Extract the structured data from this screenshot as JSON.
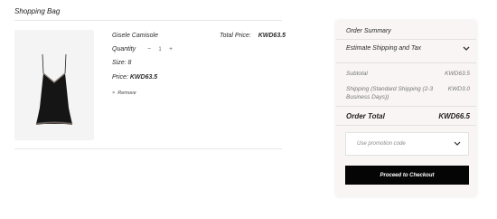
{
  "page": {
    "title": "Shopping Bag"
  },
  "item": {
    "name": "Gisele Camisole",
    "quantity_label": "Quantity",
    "quantity": "1",
    "size": "Size: 8",
    "price_label": "Price:",
    "price": "KWD63.5",
    "remove_label": "Remove",
    "total_label": "Total Price:",
    "total_value": "KWD63.5"
  },
  "summary": {
    "title": "Order Summary",
    "shipping_tax_label": "Estimate Shipping and Tax",
    "subtotal_label": "Subtotal",
    "subtotal_value": "KWD63.5",
    "shipping_label": "Shipping (Standard Shipping (2-3 Business Days))",
    "shipping_value": "KWD3.0",
    "order_total_label": "Order Total",
    "order_total_value": "KWD66.5",
    "promo_placeholder": "Use promotion code",
    "checkout_label": "Proceed to Checkout"
  },
  "icons": {
    "minus": "minus-icon",
    "plus": "plus-icon",
    "remove": "close-icon",
    "chevron": "chevron-down-icon"
  }
}
